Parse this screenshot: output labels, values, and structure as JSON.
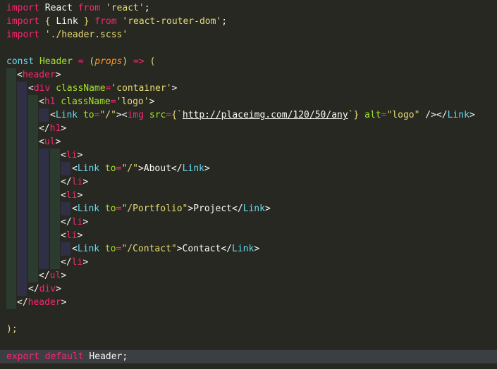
{
  "editor": {
    "lines": [
      [
        {
          "t": "import",
          "c": "kw"
        },
        {
          "t": " React ",
          "c": "ident"
        },
        {
          "t": "from",
          "c": "kw"
        },
        {
          "t": " 'react'",
          "c": "str"
        },
        {
          "t": ";",
          "c": "ident"
        }
      ],
      [
        {
          "t": "import",
          "c": "kw"
        },
        {
          "t": " { ",
          "c": "brace"
        },
        {
          "t": "Link",
          "c": "ident"
        },
        {
          "t": " } ",
          "c": "brace"
        },
        {
          "t": "from",
          "c": "kw"
        },
        {
          "t": " 'react-router-dom'",
          "c": "str"
        },
        {
          "t": ";",
          "c": "ident"
        }
      ],
      [
        {
          "t": "import",
          "c": "kw"
        },
        {
          "t": " './header.scss'",
          "c": "str"
        }
      ],
      [],
      [
        {
          "t": "const",
          "c": "kwn"
        },
        {
          "t": " Header ",
          "c": "attr"
        },
        {
          "t": "=",
          "c": "op"
        },
        {
          "t": " (",
          "c": "brace"
        },
        {
          "t": "props",
          "c": "param"
        },
        {
          "t": ") ",
          "c": "brace"
        },
        {
          "t": "=>",
          "c": "op"
        },
        {
          "t": " (",
          "c": "brace"
        }
      ],
      [
        {
          "t": "<",
          "c": "ident"
        },
        {
          "t": "header",
          "c": "tag"
        },
        {
          "t": ">",
          "c": "ident"
        }
      ],
      [
        {
          "t": "<",
          "c": "ident"
        },
        {
          "t": "div",
          "c": "tag"
        },
        {
          "t": " className",
          "c": "attr"
        },
        {
          "t": "=",
          "c": "op"
        },
        {
          "t": "'container'",
          "c": "str"
        },
        {
          "t": ">",
          "c": "ident"
        }
      ],
      [
        {
          "t": "<",
          "c": "ident"
        },
        {
          "t": "h1",
          "c": "tag"
        },
        {
          "t": " className",
          "c": "attr"
        },
        {
          "t": "=",
          "c": "op"
        },
        {
          "t": "'logo'",
          "c": "str"
        },
        {
          "t": ">",
          "c": "ident"
        }
      ],
      [
        {
          "t": "<",
          "c": "ident"
        },
        {
          "t": "Link",
          "c": "comp"
        },
        {
          "t": " to",
          "c": "attr"
        },
        {
          "t": "=",
          "c": "op"
        },
        {
          "t": "\"/\"",
          "c": "str"
        },
        {
          "t": "><",
          "c": "ident"
        },
        {
          "t": "img",
          "c": "tag"
        },
        {
          "t": " src",
          "c": "attr"
        },
        {
          "t": "=",
          "c": "op"
        },
        {
          "t": "{",
          "c": "brace"
        },
        {
          "t": "`",
          "c": "str"
        },
        {
          "t": "http://placeimg.com/120/50/any",
          "c": "url"
        },
        {
          "t": "`",
          "c": "str"
        },
        {
          "t": "}",
          "c": "brace"
        },
        {
          "t": " alt",
          "c": "attr"
        },
        {
          "t": "=",
          "c": "op"
        },
        {
          "t": "\"logo\"",
          "c": "str"
        },
        {
          "t": " /></",
          "c": "ident"
        },
        {
          "t": "Link",
          "c": "comp"
        },
        {
          "t": ">",
          "c": "ident"
        }
      ],
      [
        {
          "t": "</",
          "c": "ident"
        },
        {
          "t": "h1",
          "c": "tag"
        },
        {
          "t": ">",
          "c": "ident"
        }
      ],
      [
        {
          "t": "<",
          "c": "ident"
        },
        {
          "t": "ul",
          "c": "tag"
        },
        {
          "t": ">",
          "c": "ident"
        }
      ],
      [
        {
          "t": "<",
          "c": "ident"
        },
        {
          "t": "li",
          "c": "tag"
        },
        {
          "t": ">",
          "c": "ident"
        }
      ],
      [
        {
          "t": "<",
          "c": "ident"
        },
        {
          "t": "Link",
          "c": "comp"
        },
        {
          "t": " to",
          "c": "attr"
        },
        {
          "t": "=",
          "c": "op"
        },
        {
          "t": "\"/\"",
          "c": "str"
        },
        {
          "t": ">About</",
          "c": "txt"
        },
        {
          "t": "Link",
          "c": "comp"
        },
        {
          "t": ">",
          "c": "ident"
        }
      ],
      [
        {
          "t": "</",
          "c": "ident"
        },
        {
          "t": "li",
          "c": "tag"
        },
        {
          "t": ">",
          "c": "ident"
        }
      ],
      [
        {
          "t": "<",
          "c": "ident"
        },
        {
          "t": "li",
          "c": "tag"
        },
        {
          "t": ">",
          "c": "ident"
        }
      ],
      [
        {
          "t": "<",
          "c": "ident"
        },
        {
          "t": "Link",
          "c": "comp"
        },
        {
          "t": " to",
          "c": "attr"
        },
        {
          "t": "=",
          "c": "op"
        },
        {
          "t": "\"/Portfolio\"",
          "c": "str"
        },
        {
          "t": ">Project</",
          "c": "txt"
        },
        {
          "t": "Link",
          "c": "comp"
        },
        {
          "t": ">",
          "c": "ident"
        }
      ],
      [
        {
          "t": "</",
          "c": "ident"
        },
        {
          "t": "li",
          "c": "tag"
        },
        {
          "t": ">",
          "c": "ident"
        }
      ],
      [
        {
          "t": "<",
          "c": "ident"
        },
        {
          "t": "li",
          "c": "tag"
        },
        {
          "t": ">",
          "c": "ident"
        }
      ],
      [
        {
          "t": "<",
          "c": "ident"
        },
        {
          "t": "Link",
          "c": "comp"
        },
        {
          "t": " to",
          "c": "attr"
        },
        {
          "t": "=",
          "c": "op"
        },
        {
          "t": "\"/Contact\"",
          "c": "str"
        },
        {
          "t": ">Contact</",
          "c": "txt"
        },
        {
          "t": "Link",
          "c": "comp"
        },
        {
          "t": ">",
          "c": "ident"
        }
      ],
      [
        {
          "t": "</",
          "c": "ident"
        },
        {
          "t": "li",
          "c": "tag"
        },
        {
          "t": ">",
          "c": "ident"
        }
      ],
      [
        {
          "t": "</",
          "c": "ident"
        },
        {
          "t": "ul",
          "c": "tag"
        },
        {
          "t": ">",
          "c": "ident"
        }
      ],
      [
        {
          "t": "</",
          "c": "ident"
        },
        {
          "t": "div",
          "c": "tag"
        },
        {
          "t": ">",
          "c": "ident"
        }
      ],
      [
        {
          "t": "</",
          "c": "ident"
        },
        {
          "t": "header",
          "c": "tag"
        },
        {
          "t": ">",
          "c": "ident"
        }
      ],
      [],
      [
        {
          "t": ");",
          "c": "brace"
        }
      ],
      [],
      [
        {
          "t": "export",
          "c": "kw"
        },
        {
          "t": " ",
          "c": "ident"
        },
        {
          "t": "default",
          "c": "kw"
        },
        {
          "t": " Header;",
          "c": "ident"
        }
      ]
    ],
    "active_line": 26
  }
}
